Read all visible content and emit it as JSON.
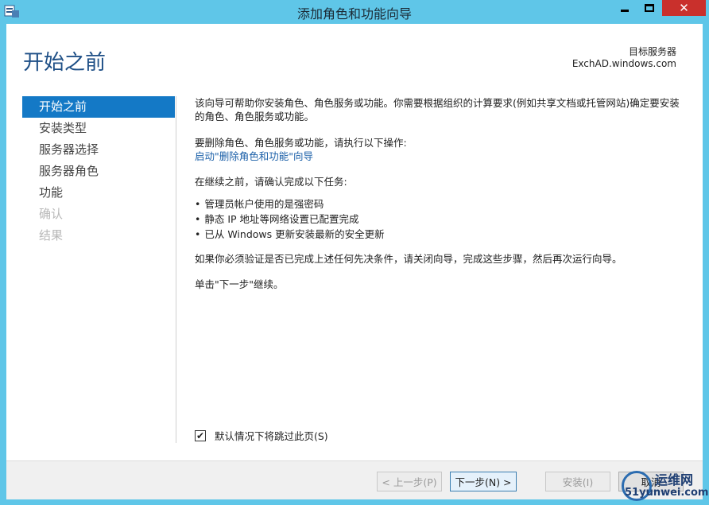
{
  "window": {
    "title": "添加角色和功能向导",
    "controls": {
      "minimize": "—",
      "maximize": "□",
      "close": "✕"
    }
  },
  "header": {
    "page_title": "开始之前",
    "target_label": "目标服务器",
    "target_server": "ExchAD.windows.com"
  },
  "nav": {
    "items": [
      {
        "label": "开始之前",
        "state": "active"
      },
      {
        "label": "安装类型",
        "state": "enabled"
      },
      {
        "label": "服务器选择",
        "state": "enabled"
      },
      {
        "label": "服务器角色",
        "state": "enabled"
      },
      {
        "label": "功能",
        "state": "enabled"
      },
      {
        "label": "确认",
        "state": "disabled"
      },
      {
        "label": "结果",
        "state": "disabled"
      }
    ]
  },
  "content": {
    "intro": "该向导可帮助你安装角色、角色服务或功能。你需要根据组织的计算要求(例如共享文档或托管网站)确定要安装的角色、角色服务或功能。",
    "remove_prompt": "要删除角色、角色服务或功能，请执行以下操作:",
    "remove_link": "启动\"删除角色和功能\"向导",
    "before_continue": "在继续之前，请确认完成以下任务:",
    "tasks": [
      "管理员帐户使用的是强密码",
      "静态 IP 地址等网络设置已配置完成",
      "已从 Windows 更新安装最新的安全更新"
    ],
    "verify_note": "如果你必须验证是否已完成上述任何先决条件，请关闭向导，完成这些步骤，然后再次运行向导。",
    "click_next": "单击\"下一步\"继续。"
  },
  "skip": {
    "label": "默认情况下将跳过此页(S)",
    "checked": true,
    "check_glyph": "✔"
  },
  "footer": {
    "prev_label": "< 上一步(P)",
    "next_label": "下一步(N) >",
    "install_label": "安装(I)",
    "cancel_label": "取消"
  },
  "watermark": {
    "line1": "运维网",
    "line2": "51yunwei.com"
  },
  "colors": {
    "frame": "#5fc6e8",
    "accent": "#1479c6",
    "title": "#1e4f86",
    "link": "#1a5fa8",
    "close_button": "#c9302c"
  }
}
